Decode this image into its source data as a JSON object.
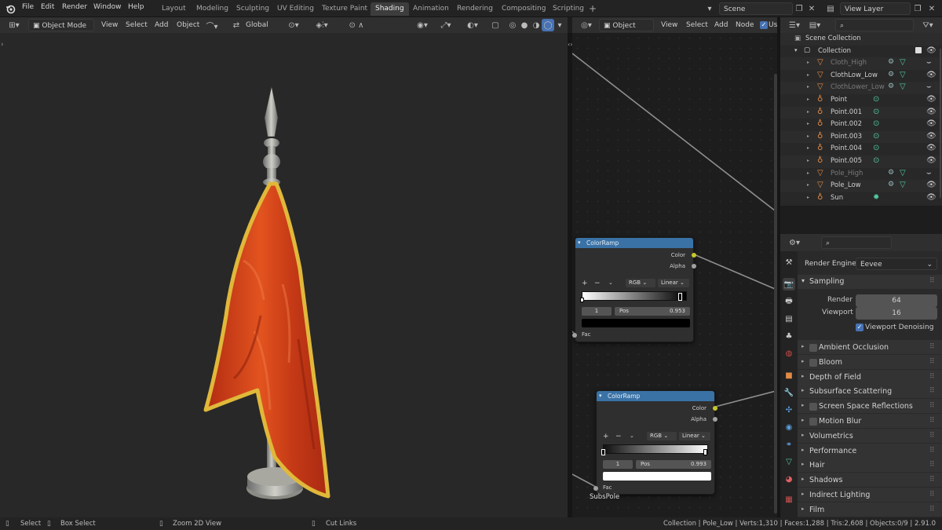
{
  "menu": {
    "items": [
      "File",
      "Edit",
      "Render",
      "Window",
      "Help"
    ]
  },
  "workspaces": {
    "tabs": [
      "Layout",
      "Modeling",
      "Sculpting",
      "UV Editing",
      "Texture Paint",
      "Shading",
      "Animation",
      "Rendering",
      "Compositing",
      "Scripting"
    ],
    "active": "Shading",
    "add_label": "+"
  },
  "scene": {
    "name": "Scene",
    "view_layer": "View Layer"
  },
  "viewport_header": {
    "mode": "Object Mode",
    "view": "View",
    "select": "Select",
    "add": "Add",
    "object": "Object",
    "orientation": "Global"
  },
  "node_header": {
    "object_type": "Object",
    "view": "View",
    "select": "Select",
    "add": "Add",
    "node": "Node",
    "use_nodes": "Us"
  },
  "nodes": [
    {
      "title": "ColorRamp",
      "out_color": "Color",
      "out_alpha": "Alpha",
      "mode": "RGB",
      "interp": "Linear",
      "index": "1",
      "pos_label": "Pos",
      "pos_value": "0.953",
      "stop_color": "#000000",
      "in_fac": "Fac",
      "frame_label": ""
    },
    {
      "title": "ColorRamp",
      "out_color": "Color",
      "out_alpha": "Alpha",
      "mode": "RGB",
      "interp": "Linear",
      "index": "1",
      "pos_label": "Pos",
      "pos_value": "0.993",
      "stop_color": "#ffffff",
      "in_fac": "Fac",
      "frame_label": "SubsPole"
    }
  ],
  "outliner": {
    "root": "Scene Collection",
    "collection": "Collection",
    "items": [
      {
        "name": "Cloth_High",
        "type": "mesh",
        "dim": true
      },
      {
        "name": "ClothLow_Low",
        "type": "mesh",
        "dim": false
      },
      {
        "name": "ClothLower_Low",
        "type": "mesh",
        "dim": true
      },
      {
        "name": "Point",
        "type": "light",
        "dim": false
      },
      {
        "name": "Point.001",
        "type": "light",
        "dim": false
      },
      {
        "name": "Point.002",
        "type": "light",
        "dim": false
      },
      {
        "name": "Point.003",
        "type": "light",
        "dim": false
      },
      {
        "name": "Point.004",
        "type": "light",
        "dim": false
      },
      {
        "name": "Point.005",
        "type": "light",
        "dim": false
      },
      {
        "name": "Pole_High",
        "type": "mesh",
        "dim": true
      },
      {
        "name": "Pole_Low",
        "type": "mesh",
        "dim": false
      },
      {
        "name": "Sun",
        "type": "sun",
        "dim": false
      }
    ]
  },
  "properties": {
    "render_engine_label": "Render Engine",
    "render_engine": "Eevee",
    "sampling": {
      "label": "Sampling",
      "render_label": "Render",
      "render_value": "64",
      "viewport_label": "Viewport",
      "viewport_value": "16",
      "denoise_label": "Viewport Denoising"
    },
    "panels": [
      {
        "label": "Ambient Occlusion",
        "checkbox": true
      },
      {
        "label": "Bloom",
        "checkbox": true
      },
      {
        "label": "Depth of Field",
        "checkbox": false
      },
      {
        "label": "Subsurface Scattering",
        "checkbox": false
      },
      {
        "label": "Screen Space Reflections",
        "checkbox": true
      },
      {
        "label": "Motion Blur",
        "checkbox": true
      },
      {
        "label": "Volumetrics",
        "checkbox": false
      },
      {
        "label": "Performance",
        "checkbox": false
      },
      {
        "label": "Hair",
        "checkbox": false
      },
      {
        "label": "Shadows",
        "checkbox": false
      },
      {
        "label": "Indirect Lighting",
        "checkbox": false
      },
      {
        "label": "Film",
        "checkbox": false
      }
    ]
  },
  "statusbar": {
    "select": "Select",
    "box_select": "Box Select",
    "zoom": "Zoom 2D View",
    "cut_links": "Cut Links",
    "stats": "Collection | Pole_Low | Verts:1,310 | Faces:1,288 | Tris:2,608 | Objects:0/9 | 2.91.0"
  },
  "colors": {
    "accent": "#4772b3",
    "node_header": "#3a72a6",
    "flag_red": "#d8421b",
    "flag_trim": "#e0b83a",
    "mesh_icon": "#e38a45",
    "data_icon": "#52c79c"
  }
}
